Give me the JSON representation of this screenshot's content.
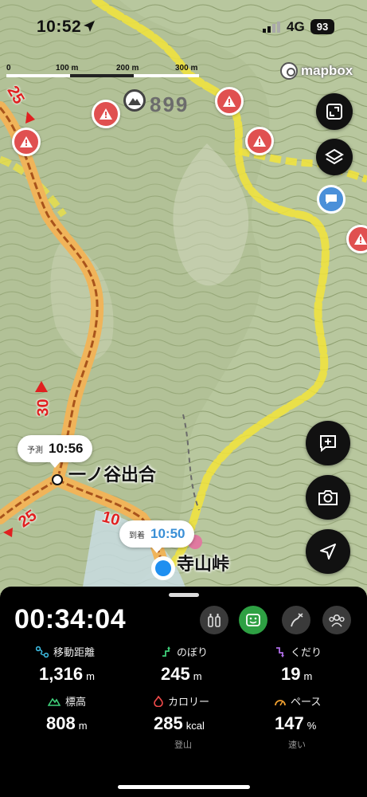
{
  "status_bar": {
    "time": "10:52",
    "network": "4G",
    "battery": "93"
  },
  "scale_bar": {
    "labels": [
      "0",
      "100 m",
      "200 m",
      "300 m"
    ]
  },
  "map": {
    "attribution": "mapbox",
    "peak_elevation": "899",
    "route_numbers": [
      "25",
      "30",
      "25",
      "10"
    ],
    "waypoints": [
      {
        "prefix": "予測",
        "time": "10:56",
        "name": "一ノ谷出合"
      },
      {
        "prefix": "到着",
        "time": "10:50",
        "name": "寺山峠"
      }
    ]
  },
  "map_controls": [
    "expand",
    "layers",
    "add-memo",
    "camera",
    "locate"
  ],
  "panel": {
    "elapsed_time": "00:34:04",
    "stats": [
      {
        "label": "移動距離",
        "value": "1,316",
        "unit": "m",
        "note": ""
      },
      {
        "label": "のぼり",
        "value": "245",
        "unit": "m",
        "note": ""
      },
      {
        "label": "くだり",
        "value": "19",
        "unit": "m",
        "note": ""
      },
      {
        "label": "標高",
        "value": "808",
        "unit": "m",
        "note": ""
      },
      {
        "label": "カロリー",
        "value": "285",
        "unit": "kcal",
        "note": "登山"
      },
      {
        "label": "ペース",
        "value": "147",
        "unit": "%",
        "note": "速い"
      }
    ]
  },
  "colors": {
    "route": "#c97a2b",
    "trail_highlight": "#f2e43a",
    "warning": "#e05050",
    "accent_blue": "#3a8fd6",
    "active_green": "#2ea043"
  }
}
